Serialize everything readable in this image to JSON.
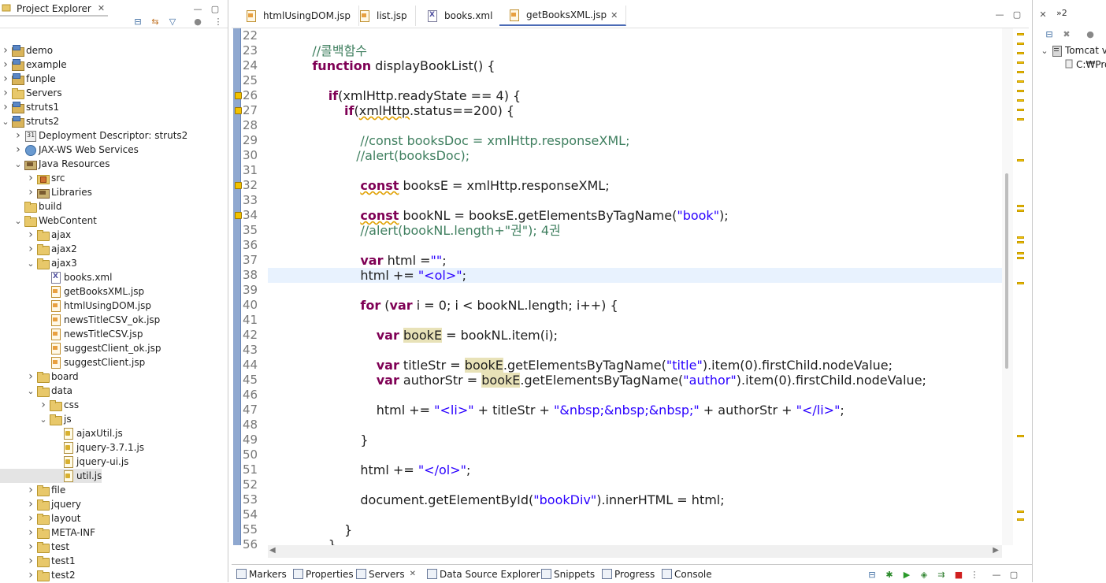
{
  "project_explorer": {
    "title": "Project Explorer",
    "items": [
      {
        "label": "demo",
        "depth": 0,
        "icon": "project-icon",
        "twisty": "collapsed"
      },
      {
        "label": "example",
        "depth": 0,
        "icon": "project-icon",
        "twisty": "collapsed"
      },
      {
        "label": "funple",
        "depth": 0,
        "icon": "project-icon",
        "twisty": "collapsed"
      },
      {
        "label": "Servers",
        "depth": 0,
        "icon": "folder-icon",
        "twisty": "collapsed"
      },
      {
        "label": "struts1",
        "depth": 0,
        "icon": "project-icon",
        "twisty": "collapsed"
      },
      {
        "label": "struts2",
        "depth": 0,
        "icon": "project-icon",
        "twisty": "expanded"
      },
      {
        "label": "Deployment Descriptor: struts2",
        "depth": 1,
        "icon": "descriptor-icon",
        "twisty": "collapsed"
      },
      {
        "label": "JAX-WS Web Services",
        "depth": 1,
        "icon": "webservice-icon",
        "twisty": "collapsed"
      },
      {
        "label": "Java Resources",
        "depth": 1,
        "icon": "library-icon",
        "twisty": "expanded"
      },
      {
        "label": "src",
        "depth": 2,
        "icon": "package-icon",
        "twisty": "collapsed"
      },
      {
        "label": "Libraries",
        "depth": 2,
        "icon": "library-icon",
        "twisty": "collapsed"
      },
      {
        "label": "build",
        "depth": 1,
        "icon": "folder-icon",
        "twisty": "none"
      },
      {
        "label": "WebContent",
        "depth": 1,
        "icon": "folder-icon",
        "twisty": "expanded"
      },
      {
        "label": "ajax",
        "depth": 2,
        "icon": "folder-icon",
        "twisty": "collapsed"
      },
      {
        "label": "ajax2",
        "depth": 2,
        "icon": "folder-icon",
        "twisty": "collapsed"
      },
      {
        "label": "ajax3",
        "depth": 2,
        "icon": "folder-icon",
        "twisty": "expanded"
      },
      {
        "label": "books.xml",
        "depth": 3,
        "icon": "xml-file-icon",
        "twisty": "none"
      },
      {
        "label": "getBooksXML.jsp",
        "depth": 3,
        "icon": "jsp-file-icon",
        "twisty": "none"
      },
      {
        "label": "htmlUsingDOM.jsp",
        "depth": 3,
        "icon": "jsp-file-icon",
        "twisty": "none"
      },
      {
        "label": "newsTitleCSV_ok.jsp",
        "depth": 3,
        "icon": "jsp-file-icon",
        "twisty": "none"
      },
      {
        "label": "newsTitleCSV.jsp",
        "depth": 3,
        "icon": "jsp-file-icon",
        "twisty": "none"
      },
      {
        "label": "suggestClient_ok.jsp",
        "depth": 3,
        "icon": "jsp-file-icon",
        "twisty": "none"
      },
      {
        "label": "suggestClient.jsp",
        "depth": 3,
        "icon": "jsp-file-icon",
        "twisty": "none"
      },
      {
        "label": "board",
        "depth": 2,
        "icon": "folder-icon",
        "twisty": "collapsed"
      },
      {
        "label": "data",
        "depth": 2,
        "icon": "folder-icon",
        "twisty": "expanded"
      },
      {
        "label": "css",
        "depth": 3,
        "icon": "folder-icon",
        "twisty": "collapsed"
      },
      {
        "label": "js",
        "depth": 3,
        "icon": "folder-icon",
        "twisty": "expanded"
      },
      {
        "label": "ajaxUtil.js",
        "depth": 4,
        "icon": "js-file-icon",
        "twisty": "none"
      },
      {
        "label": "jquery-3.7.1.js",
        "depth": 4,
        "icon": "js-file-icon",
        "twisty": "none"
      },
      {
        "label": "jquery-ui.js",
        "depth": 4,
        "icon": "js-file-icon",
        "twisty": "none"
      },
      {
        "label": "util.js",
        "depth": 4,
        "icon": "js-file-icon",
        "twisty": "none",
        "selected": true
      },
      {
        "label": "file",
        "depth": 2,
        "icon": "folder-icon",
        "twisty": "collapsed"
      },
      {
        "label": "jquery",
        "depth": 2,
        "icon": "folder-icon",
        "twisty": "collapsed"
      },
      {
        "label": "layout",
        "depth": 2,
        "icon": "folder-icon",
        "twisty": "collapsed"
      },
      {
        "label": "META-INF",
        "depth": 2,
        "icon": "folder-icon",
        "twisty": "collapsed"
      },
      {
        "label": "test",
        "depth": 2,
        "icon": "folder-icon",
        "twisty": "collapsed"
      },
      {
        "label": "test1",
        "depth": 2,
        "icon": "folder-icon",
        "twisty": "collapsed"
      },
      {
        "label": "test2",
        "depth": 2,
        "icon": "folder-icon",
        "twisty": "collapsed"
      }
    ]
  },
  "editor": {
    "tabs": [
      {
        "label": "htmlUsingDOM.jsp",
        "icon": "jsp-file-icon",
        "active": false
      },
      {
        "label": "list.jsp",
        "icon": "jsp-file-icon",
        "active": false
      },
      {
        "label": "books.xml",
        "icon": "xml-file-icon",
        "active": false
      },
      {
        "label": "getBooksXML.jsp",
        "icon": "jsp-file-icon",
        "active": true
      }
    ],
    "lines": [
      {
        "n": "22",
        "segs": []
      },
      {
        "n": "23",
        "segs": [
          {
            "t": "    "
          },
          {
            "t": "//콜백함수",
            "c": "cm"
          }
        ]
      },
      {
        "n": "24",
        "segs": [
          {
            "t": "    "
          },
          {
            "t": "function",
            "c": "kw"
          },
          {
            "t": " displayBookList() {"
          }
        ]
      },
      {
        "n": "25",
        "segs": []
      },
      {
        "n": "26",
        "warn": true,
        "segs": [
          {
            "t": "        "
          },
          {
            "t": "if",
            "c": "kw"
          },
          {
            "t": "(xmlHttp.readyState == 4) {"
          }
        ]
      },
      {
        "n": "27",
        "warn": true,
        "segs": [
          {
            "t": "            "
          },
          {
            "t": "if",
            "c": "kw"
          },
          {
            "t": "("
          },
          {
            "t": "xmlHttp",
            "c": "squig"
          },
          {
            "t": ".status==200) {"
          }
        ]
      },
      {
        "n": "28",
        "segs": []
      },
      {
        "n": "29",
        "segs": [
          {
            "t": "                "
          },
          {
            "t": "//const booksDoc = xmlHttp.responseXML;",
            "c": "cm"
          }
        ]
      },
      {
        "n": "30",
        "segs": [
          {
            "t": "               "
          },
          {
            "t": "//alert(booksDoc);",
            "c": "cm"
          }
        ]
      },
      {
        "n": "31",
        "segs": []
      },
      {
        "n": "32",
        "warn": true,
        "segs": [
          {
            "t": "                "
          },
          {
            "t": "const",
            "c": "kw squig"
          },
          {
            "t": " booksE = xmlHttp.responseXML;"
          }
        ]
      },
      {
        "n": "33",
        "segs": []
      },
      {
        "n": "34",
        "warn": true,
        "segs": [
          {
            "t": "                "
          },
          {
            "t": "const",
            "c": "kw squig"
          },
          {
            "t": " bookNL = booksE.getElementsByTagName("
          },
          {
            "t": "\"book\"",
            "c": "st"
          },
          {
            "t": ");"
          }
        ]
      },
      {
        "n": "35",
        "segs": [
          {
            "t": "                "
          },
          {
            "t": "//alert(bookNL.length+\"권\"); 4권",
            "c": "cm"
          }
        ]
      },
      {
        "n": "36",
        "segs": []
      },
      {
        "n": "37",
        "segs": [
          {
            "t": "                "
          },
          {
            "t": "var",
            "c": "kw"
          },
          {
            "t": " html ="
          },
          {
            "t": "\"\"",
            "c": "st"
          },
          {
            "t": ";"
          }
        ]
      },
      {
        "n": "38",
        "hl": true,
        "segs": [
          {
            "t": "                html += "
          },
          {
            "t": "\"<ol>\"",
            "c": "st"
          },
          {
            "t": ";"
          }
        ]
      },
      {
        "n": "39",
        "segs": []
      },
      {
        "n": "40",
        "segs": [
          {
            "t": "                "
          },
          {
            "t": "for",
            "c": "kw"
          },
          {
            "t": " ("
          },
          {
            "t": "var",
            "c": "kw"
          },
          {
            "t": " i = 0; i < bookNL.length; i++) {"
          }
        ]
      },
      {
        "n": "41",
        "segs": []
      },
      {
        "n": "42",
        "segs": [
          {
            "t": "                    "
          },
          {
            "t": "var",
            "c": "kw"
          },
          {
            "t": " "
          },
          {
            "t": "bookE",
            "c": "occ"
          },
          {
            "t": " = bookNL.item(i);"
          }
        ]
      },
      {
        "n": "43",
        "segs": []
      },
      {
        "n": "44",
        "segs": [
          {
            "t": "                    "
          },
          {
            "t": "var",
            "c": "kw"
          },
          {
            "t": " titleStr = "
          },
          {
            "t": "bookE",
            "c": "occ"
          },
          {
            "t": ".getElementsByTagName("
          },
          {
            "t": "\"title\"",
            "c": "st"
          },
          {
            "t": ").item(0).firstChild.nodeValue;"
          }
        ]
      },
      {
        "n": "45",
        "segs": [
          {
            "t": "                    "
          },
          {
            "t": "var",
            "c": "kw"
          },
          {
            "t": " authorStr = "
          },
          {
            "t": "bookE",
            "c": "occ"
          },
          {
            "t": ".getElementsByTagName("
          },
          {
            "t": "\"author\"",
            "c": "st"
          },
          {
            "t": ").item(0).firstChild.nodeValue;"
          }
        ]
      },
      {
        "n": "46",
        "segs": []
      },
      {
        "n": "47",
        "segs": [
          {
            "t": "                    html += "
          },
          {
            "t": "\"<li>\"",
            "c": "st"
          },
          {
            "t": " + titleStr + "
          },
          {
            "t": "\"&nbsp;&nbsp;&nbsp;\"",
            "c": "st"
          },
          {
            "t": " + authorStr + "
          },
          {
            "t": "\"</li>\"",
            "c": "st"
          },
          {
            "t": ";"
          }
        ]
      },
      {
        "n": "48",
        "segs": []
      },
      {
        "n": "49",
        "segs": [
          {
            "t": "                }"
          }
        ]
      },
      {
        "n": "50",
        "segs": []
      },
      {
        "n": "51",
        "segs": [
          {
            "t": "                html += "
          },
          {
            "t": "\"</ol>\"",
            "c": "st"
          },
          {
            "t": ";"
          }
        ]
      },
      {
        "n": "52",
        "segs": []
      },
      {
        "n": "53",
        "segs": [
          {
            "t": "                document.getElementById("
          },
          {
            "t": "\"bookDiv\"",
            "c": "st"
          },
          {
            "t": ").innerHTML = html;"
          }
        ]
      },
      {
        "n": "54",
        "segs": []
      },
      {
        "n": "55",
        "segs": [
          {
            "t": "            }"
          }
        ]
      },
      {
        "n": "56",
        "segs": [
          {
            "t": "        }"
          }
        ]
      }
    ]
  },
  "servers_view": {
    "tab_label": "»2",
    "items": [
      {
        "label": "Tomcat v"
      },
      {
        "label": "C:₩Pro"
      }
    ]
  },
  "bottom_bar": {
    "tabs": [
      {
        "label": "Markers",
        "icon": "markers-icon"
      },
      {
        "label": "Properties",
        "icon": "properties-icon"
      },
      {
        "label": "Servers",
        "icon": "servers-icon",
        "closable": true
      },
      {
        "label": "Data Source Explorer",
        "icon": "data-source-icon"
      },
      {
        "label": "Snippets",
        "icon": "snippets-icon"
      },
      {
        "label": "Progress",
        "icon": "progress-icon"
      },
      {
        "label": "Console",
        "icon": "console-icon"
      }
    ]
  },
  "colors": {
    "keyword": "#7f0055",
    "comment": "#3f7f5f",
    "string": "#2a00ff",
    "line_highlight": "#e8f2fe",
    "warning": "#f2c200"
  }
}
